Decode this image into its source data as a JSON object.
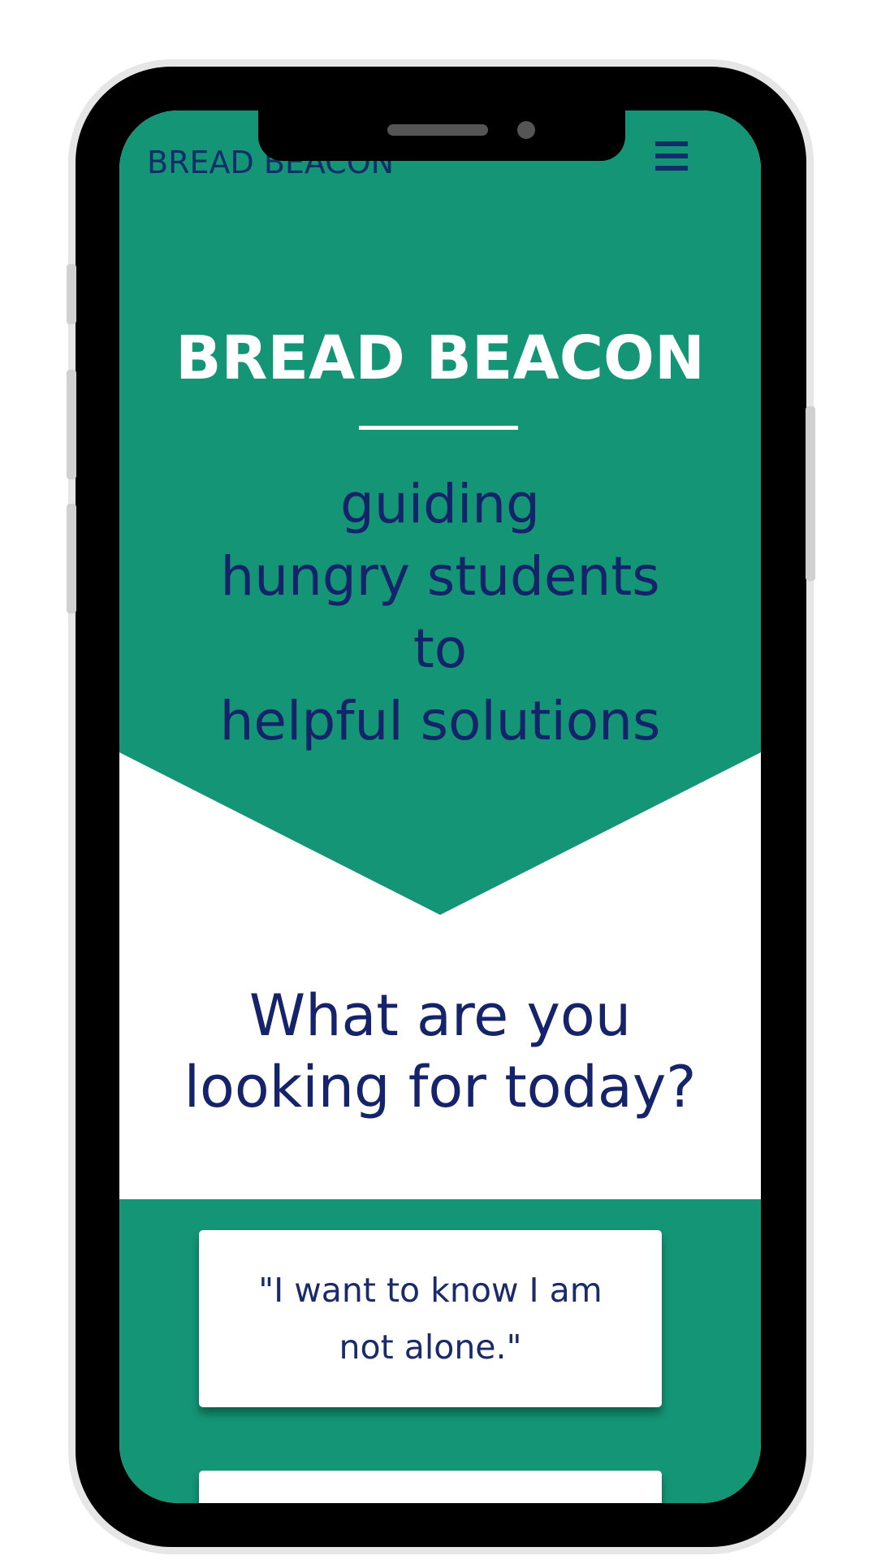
{
  "colors": {
    "brand_green": "#149575",
    "navy_text": "#15236a",
    "white": "#ffffff",
    "device_frame": "#000000"
  },
  "header": {
    "brand_label": "BREAD BEACON",
    "menu_icon": "hamburger-menu-icon"
  },
  "hero": {
    "title": "BREAD BEACON",
    "tagline_lines": [
      "guiding",
      "hungry students",
      "to",
      "helpful solutions"
    ]
  },
  "prompt": {
    "lines": [
      "What are you",
      "looking for today?"
    ]
  },
  "options": [
    {
      "label": "\"I want to know I am not alone.\""
    },
    {
      "label": ""
    }
  ]
}
